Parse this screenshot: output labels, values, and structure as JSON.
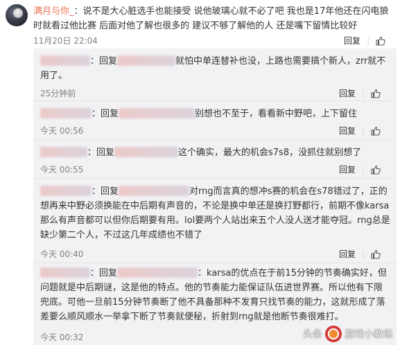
{
  "main": {
    "username": "满月与你_",
    "separator": "：",
    "text": "说不是大心脏选手也能接受 说他玻璃心就不必了吧 我也是17年他还在闪电狼时就看过他比赛 后面对他了解也很多的 建议不够了解他的人 还是嘴下留情比较好",
    "time": "11月20日 22:04",
    "reply_label": "回复",
    "like_icon": "thumbs-up-icon"
  },
  "replies": [
    {
      "prefix": "：回复",
      "tail": "就怕中单连替补也没，上路也需要搞个新人，zrr就不用了。",
      "time": "25分钟前",
      "reply_label": "回复"
    },
    {
      "prefix": "：回复",
      "tail": "别想也不至于，看看新中野吧，上下留住",
      "time": "今天 00:56",
      "reply_label": "回复"
    },
    {
      "prefix": "：回复",
      "tail": "这个确实，最大的机会s7s8，没抓住就别想了",
      "time": "今天 00:55",
      "reply_label": "回复"
    },
    {
      "prefix": "：回复",
      "tail": "对rng而言真的想冲s赛的机会在s78错过了，正的想再来中野必须换能在中后期有声音的，不论是换中单还是换打野都行，前期不像karsa那么有声音都可以但你后期要有用。lol要两个人站出来五个人没人送才能夺冠。rng总是缺少第二个人，不过这几年成绩也不错了",
      "time": "今天 00:40",
      "reply_label": "回复"
    },
    {
      "prefix": "：回复",
      "tail": "：karsa的优点在于前15分钟的节奏确实好，但问题就是中后期谜，这是他的特点。他的节奏能力能保证队伍进世界赛。所以他有下限兜底。可他一旦前15分钟节奏断了他不具备那种不发育只找节奏的能力，这就形成了落差要么顺风顺水一举拿下断了节奏就便秘，折射到rng就是他断节奏很难打。",
      "time": "今天 00:32",
      "reply_label": "回复"
    }
  ],
  "watermark": {
    "left": "头条",
    "right": "游戏小教练"
  }
}
